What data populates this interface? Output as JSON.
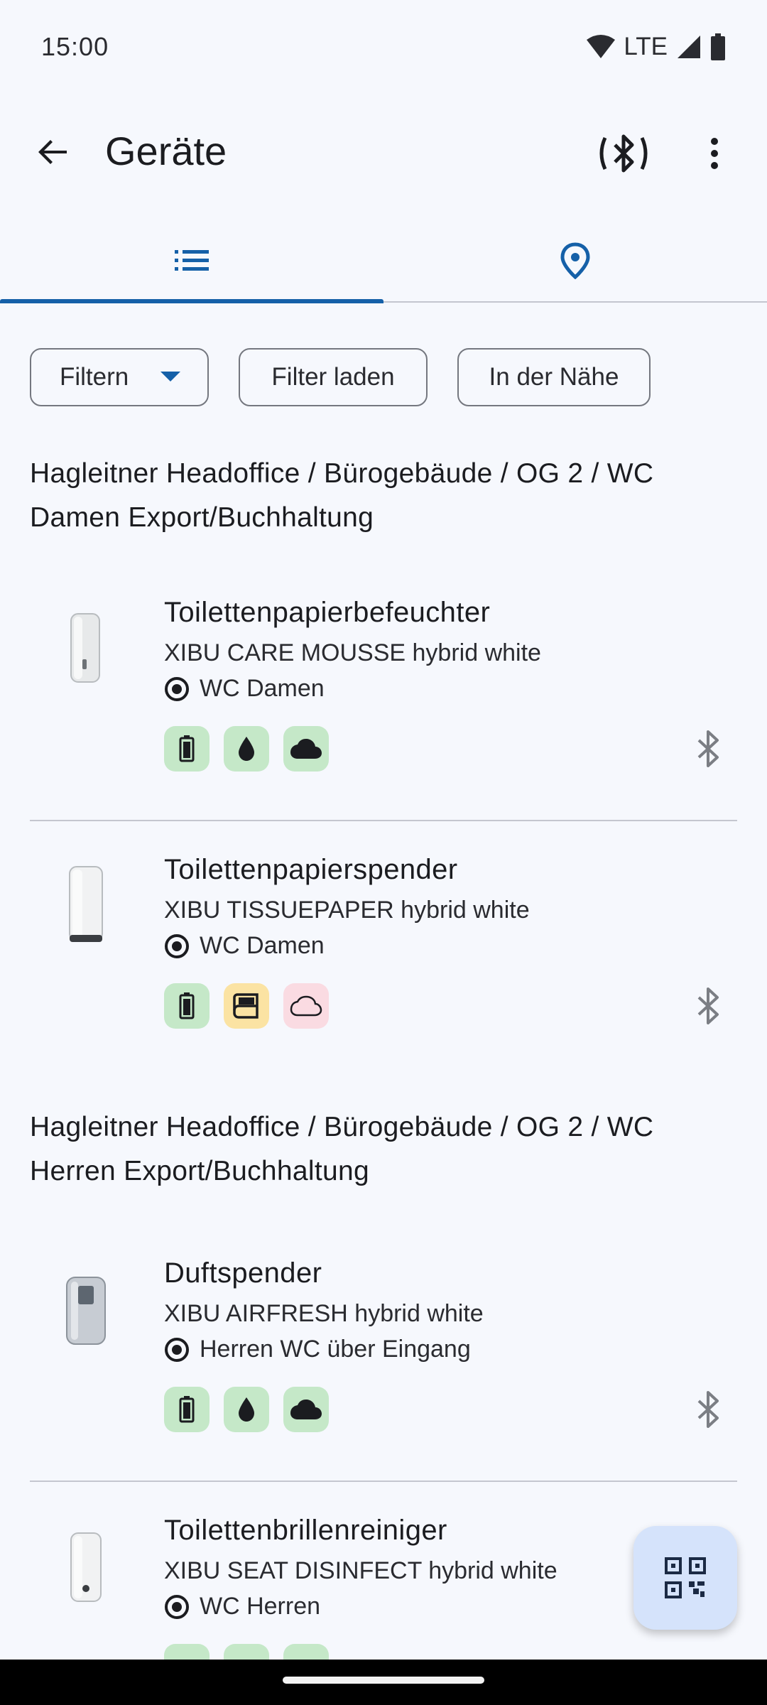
{
  "status_bar": {
    "time": "15:00",
    "network": "LTE"
  },
  "app_bar": {
    "title": "Geräte"
  },
  "tabs": [
    {
      "id": "list",
      "icon": "list-icon",
      "selected": true
    },
    {
      "id": "map",
      "icon": "location-pin-icon",
      "selected": false
    }
  ],
  "filters": {
    "filter_label": "Filtern",
    "load_label": "Filter laden",
    "nearby_label": "In der Nähe"
  },
  "groups": [
    {
      "header": "Hagleitner Headoffice / Bürogebäude / OG 2 / WC Damen Export/Buchhaltung",
      "devices": [
        {
          "name": "Toilettenpapierbefeuchter",
          "model": "XIBU CARE MOUSSE hybrid white",
          "location": "WC Damen",
          "badges": [
            "battery-icon",
            "drop-icon",
            "cloud-icon"
          ]
        },
        {
          "name": "Toilettenpapierspender",
          "model": "XIBU TISSUEPAPER hybrid white",
          "location": "WC Damen",
          "badges": [
            "battery-icon",
            "paper-roll-icon",
            "cloud-outline-icon"
          ]
        }
      ]
    },
    {
      "header": "Hagleitner Headoffice / Bürogebäude / OG 2 / WC Herren Export/Buchhaltung",
      "devices": [
        {
          "name": "Duftspender",
          "model": "XIBU AIRFRESH hybrid white",
          "location": "Herren WC über Eingang",
          "badges": [
            "battery-icon",
            "drop-icon",
            "cloud-icon"
          ]
        },
        {
          "name": "Toilettenbrillenreiniger",
          "model": "XIBU SEAT DISINFECT hybrid white",
          "location": "WC Herren",
          "badges": [
            "battery-icon",
            "drop-icon",
            "cloud-icon"
          ]
        }
      ]
    }
  ],
  "colors": {
    "accent": "#1560a8",
    "badge_ok": "#c5e8c8",
    "badge_warn": "#fbe3a3",
    "badge_error": "#fadbe2",
    "fab": "#d5e3fb"
  }
}
